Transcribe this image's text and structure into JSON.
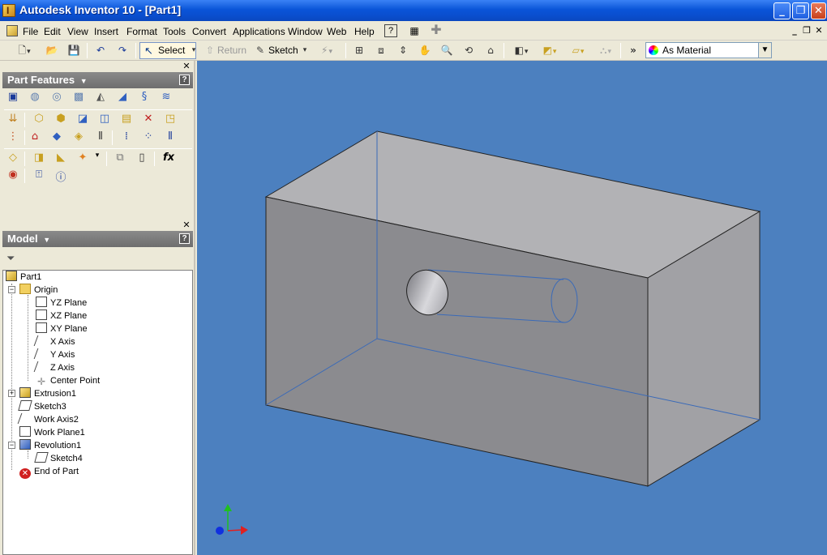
{
  "window": {
    "title": "Autodesk Inventor 10 - [Part1]",
    "buttons": {
      "minimize": "_",
      "maximize": "❐",
      "close": "✕"
    }
  },
  "menu": {
    "items": [
      "File",
      "Edit",
      "View",
      "Insert",
      "Format",
      "Tools",
      "Convert",
      "Applications",
      "Window",
      "Web",
      "Help"
    ],
    "mdi": {
      "minimize": "_",
      "restore": "❐",
      "close": "✕"
    }
  },
  "toolbar": {
    "select_label": "Select",
    "return_label": "Return",
    "sketch_label": "Sketch",
    "material": "As Material"
  },
  "panels": {
    "part_features": {
      "title": "Part Features",
      "close": "✕",
      "help": "?"
    },
    "model": {
      "title": "Model",
      "close": "✕",
      "help": "?"
    }
  },
  "tree": {
    "root": "Part1",
    "origin": "Origin",
    "origin_items": [
      "YZ Plane",
      "XZ Plane",
      "XY Plane",
      "X Axis",
      "Y Axis",
      "Z Axis",
      "Center Point"
    ],
    "features": [
      "Extrusion1",
      "Sketch3",
      "Work Axis2",
      "Work Plane1",
      "Revolution1",
      "Sketch4",
      "End of Part"
    ]
  },
  "colors": {
    "viewport_bg": "#4c80bf",
    "titlebar": "#0a55d8",
    "axis_x": "#e02020",
    "axis_y": "#20c020",
    "axis_z": "#1030e0"
  }
}
